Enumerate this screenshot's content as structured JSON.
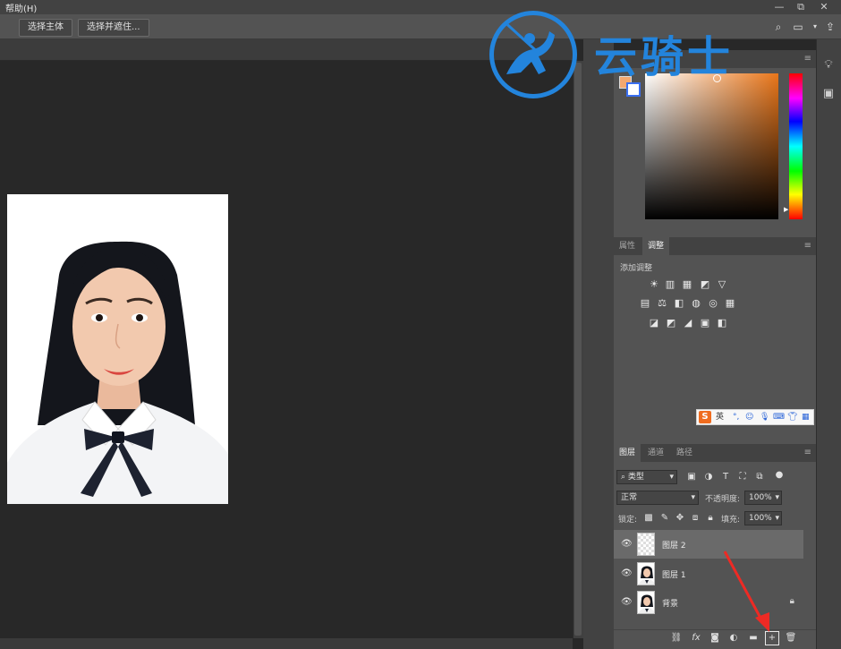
{
  "menubar": {
    "help": "帮助(H)"
  },
  "window_controls": {
    "minimize": "—",
    "restore": "⧉",
    "close": "✕"
  },
  "options_bar": {
    "select_subject": "选择主体",
    "select_and_mask": "选择并遮住..."
  },
  "panels": {
    "color": {
      "foreground": "#f3a86f",
      "background": "#ffffff",
      "hue_base": "#e9761a"
    },
    "adjustments": {
      "tabs": [
        "属性",
        "调整"
      ],
      "active_tab": "调整",
      "caption": "添加调整",
      "row1": [
        "☀",
        "▥",
        "▦",
        "◩",
        "▽"
      ],
      "row2": [
        "▤",
        "⚖",
        "◧",
        "◍",
        "◎",
        "▦"
      ],
      "row3": [
        "◪",
        "◩",
        "◢",
        "▣",
        "◧"
      ]
    },
    "layers": {
      "tabs": [
        "图层",
        "通道",
        "路径"
      ],
      "active_tab": "图层",
      "filter_kind": "类型",
      "blend_mode": "正常",
      "opacity_label": "不透明度:",
      "opacity": "100%",
      "lock_label": "锁定:",
      "fill_label": "填充:",
      "fill": "100%",
      "layers": [
        {
          "name": "图层 2",
          "selected": true
        },
        {
          "name": "图层 1",
          "selected": false
        },
        {
          "name": "背景",
          "selected": false,
          "locked": true
        }
      ]
    }
  },
  "ime": {
    "mode": "英"
  },
  "watermark": {
    "text": "云骑士"
  }
}
